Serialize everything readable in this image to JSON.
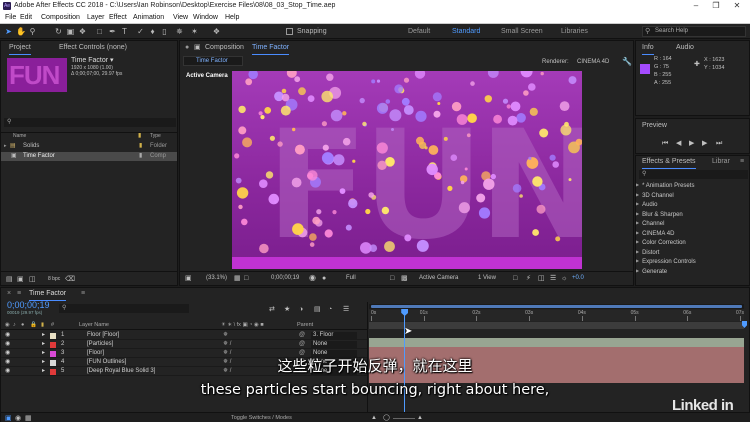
{
  "window": {
    "title": "Adobe After Effects CC 2018 - C:\\Users\\Ian Robinson\\Desktop\\Exercise Files\\08\\08_03_Stop_Time.aep",
    "app_icon_text": "Ae"
  },
  "menu": [
    "File",
    "Edit",
    "Composition",
    "Layer",
    "Effect",
    "Animation",
    "View",
    "Window",
    "Help"
  ],
  "toolbar": {
    "snapping_label": "Snapping",
    "workspaces": [
      "Default",
      "Standard",
      "Small Screen",
      "Libraries"
    ],
    "active_workspace": "Standard",
    "search_placeholder": "Search Help"
  },
  "project_panel": {
    "tab_project": "Project",
    "tab_effect_controls": "Effect Controls (none)",
    "selected_name": "Time Factor ▾",
    "selected_info1": "1920 x 1080 (1.00)",
    "selected_info2": "Δ 0;00;07;00, 29.97 fps",
    "thumb_text": "FUN",
    "columns": {
      "name": "Name",
      "type": "Type"
    },
    "items": [
      {
        "name": "Solids",
        "type": "Folder"
      },
      {
        "name": "Time Factor",
        "type": "Comp"
      }
    ],
    "bpc": "8 bpc"
  },
  "comp_panel": {
    "tab_label": "Composition",
    "comp_name": "Time Factor",
    "comp_sub_tab": "Time Factor",
    "renderer_label": "Renderer:",
    "renderer_value": "CINEMA 4D",
    "camera_label": "Active Camera",
    "fun_text": "FUN",
    "footer": {
      "zoom": "(33.1%)",
      "timecode": "0;00;00;19",
      "resolution": "Full",
      "camera": "Active Camera",
      "views": "1 View",
      "offset": "+0.0"
    }
  },
  "info_panel": {
    "tab_info": "Info",
    "tab_audio": "Audio",
    "r": "R : 164",
    "g": "G : 75",
    "b": "B : 255",
    "a": "A : 255",
    "x": "X : 1623",
    "y": "Y : 1034",
    "swatch_color": "#a44bff"
  },
  "preview_panel": {
    "tab": "Preview"
  },
  "effects_panel": {
    "tab": "Effects & Presets",
    "tab2": "Librar",
    "search_placeholder": "",
    "items": [
      "* Animation Presets",
      "3D Channel",
      "Audio",
      "Blur & Sharpen",
      "Channel",
      "CINEMA 4D",
      "Color Correction",
      "Distort",
      "Expression Controls",
      "Generate"
    ]
  },
  "timeline": {
    "tab": "Time Factor",
    "timecode": "0;00;00;19",
    "frame_info": "00019 (29.97 fps)",
    "columns": {
      "layer_name": "Layer Name",
      "parent": "Parent"
    },
    "layers": [
      {
        "num": "1",
        "name": "Floor [Floor]",
        "color": "#e8e0c4",
        "parent": "3. Floor"
      },
      {
        "num": "2",
        "name": "[Particles]",
        "color": "#e03a3a",
        "parent": "None"
      },
      {
        "num": "3",
        "name": "[Floor]",
        "color": "#d94ad6",
        "parent": "None"
      },
      {
        "num": "4",
        "name": "[FUN Outlines]",
        "color": "#d8d8d8",
        "parent": "None"
      },
      {
        "num": "5",
        "name": "[Deep Royal Blue Solid 3]",
        "color": "#e03a3a",
        "parent": "None"
      }
    ],
    "ruler": [
      "0s",
      "01s",
      "02s",
      "03s",
      "04s",
      "05s",
      "06s",
      "07s"
    ],
    "toggle_label": "Toggle Switches / Modes",
    "playhead_seconds": 0.63,
    "duration_seconds": 7
  },
  "subtitles": {
    "zh": "这些粒子开始反弹，就在这里",
    "en": "these particles start bouncing, right about here,"
  },
  "watermark": "Linked in"
}
